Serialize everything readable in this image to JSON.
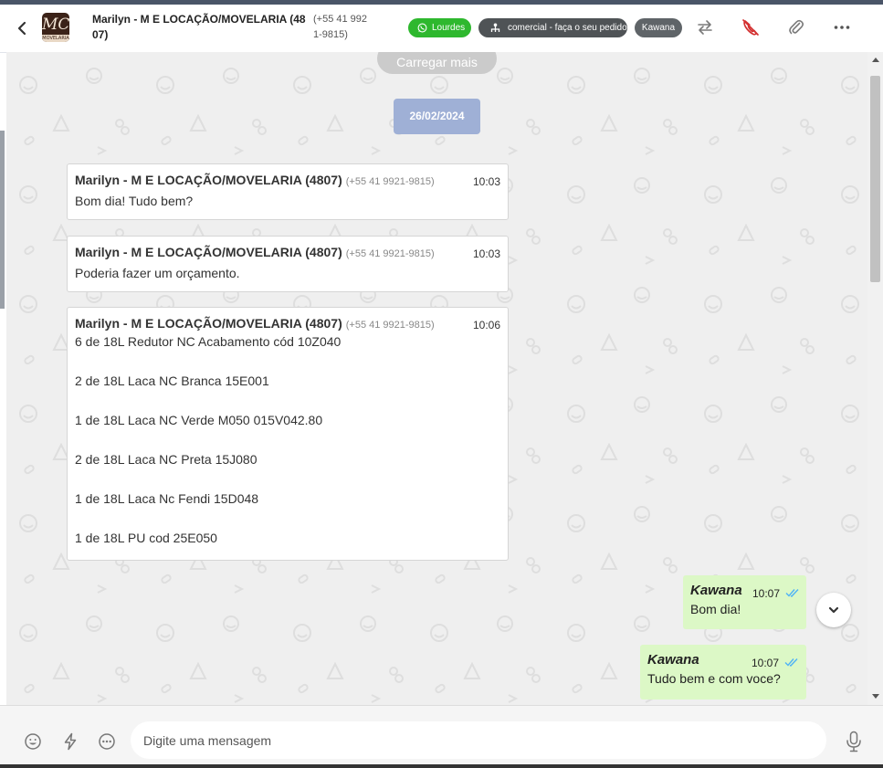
{
  "header": {
    "contact_name": "Marilyn - M E LOCAÇÃO/MOVELARIA (4807)",
    "contact_phone": "(+55 41 9921-9815)",
    "avatar_text": "MC",
    "avatar_sub": "MOVELARIA",
    "tags": {
      "whatsapp": "Lourdes",
      "department": "comercial - faça o seu pedido",
      "agent": "Kawana"
    }
  },
  "chat": {
    "load_more": "Carregar mais",
    "date": "26/02/2024",
    "messages_in": [
      {
        "sender": "Marilyn - M E LOCAÇÃO/MOVELARIA (4807)",
        "phone": "(+55 41 9921-9815)",
        "time": "10:03",
        "text": "Bom dia! Tudo bem?"
      },
      {
        "sender": "Marilyn - M E LOCAÇÃO/MOVELARIA (4807)",
        "phone": "(+55 41 9921-9815)",
        "time": "10:03",
        "text": "Poderia fazer um orçamento."
      },
      {
        "sender": "Marilyn - M E LOCAÇÃO/MOVELARIA (4807)",
        "phone": "(+55 41 9921-9815)",
        "time": "10:06",
        "text": "6 de 18L Redutor NC Acabamento cód 10Z040\n\n2 de 18L Laca NC Branca 15E001\n\n1 de 18L Laca NC Verde M050 015V042.80\n\n2 de 18L Laca NC Preta 15J080\n\n1 de 18L Laca Nc Fendi 15D048\n\n1 de 18L PU cod 25E050"
      }
    ],
    "messages_out": [
      {
        "sender": "Kawana",
        "time": "10:07",
        "text": "Bom dia!"
      },
      {
        "sender": "Kawana",
        "time": "10:07",
        "text": "Tudo bem e com voce?"
      }
    ]
  },
  "composer": {
    "placeholder": "Digite uma mensagem"
  },
  "colors": {
    "whatsapp_green": "#2eb82e",
    "outgoing_bubble": "#dcf8c6",
    "date_badge": "#9fb0d6",
    "read_ticks": "#4fb3f6",
    "hangup_red": "#d32f2f"
  }
}
